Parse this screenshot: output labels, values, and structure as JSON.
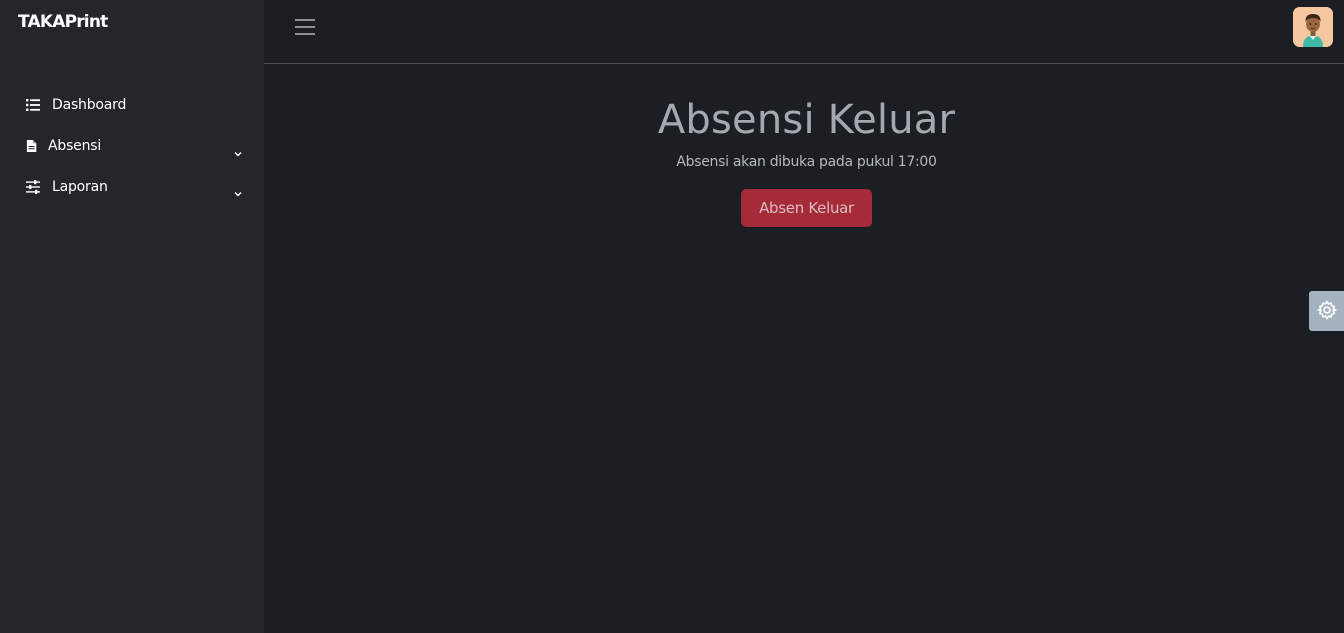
{
  "app": {
    "brand": "TAKAPrint"
  },
  "sidebar": {
    "items": [
      {
        "label": "Dashboard",
        "icon": "list-icon",
        "expandable": false
      },
      {
        "label": "Absensi",
        "icon": "file-icon",
        "expandable": true
      },
      {
        "label": "Laporan",
        "icon": "sliders-icon",
        "expandable": true
      }
    ]
  },
  "topbar": {
    "menu_icon": "hamburger-icon",
    "avatar_icon": "user-avatar"
  },
  "main": {
    "title": "Absensi Keluar",
    "subtitle": "Absensi akan dibuka pada pukul 17:00",
    "button_label": "Absen Keluar"
  },
  "settings": {
    "icon": "gear-icon"
  },
  "colors": {
    "sidebar_bg": "#23262b",
    "page_bg": "#1b1e22",
    "button_bg": "#a62b38",
    "settings_tab_bg": "#a4b2bf"
  }
}
